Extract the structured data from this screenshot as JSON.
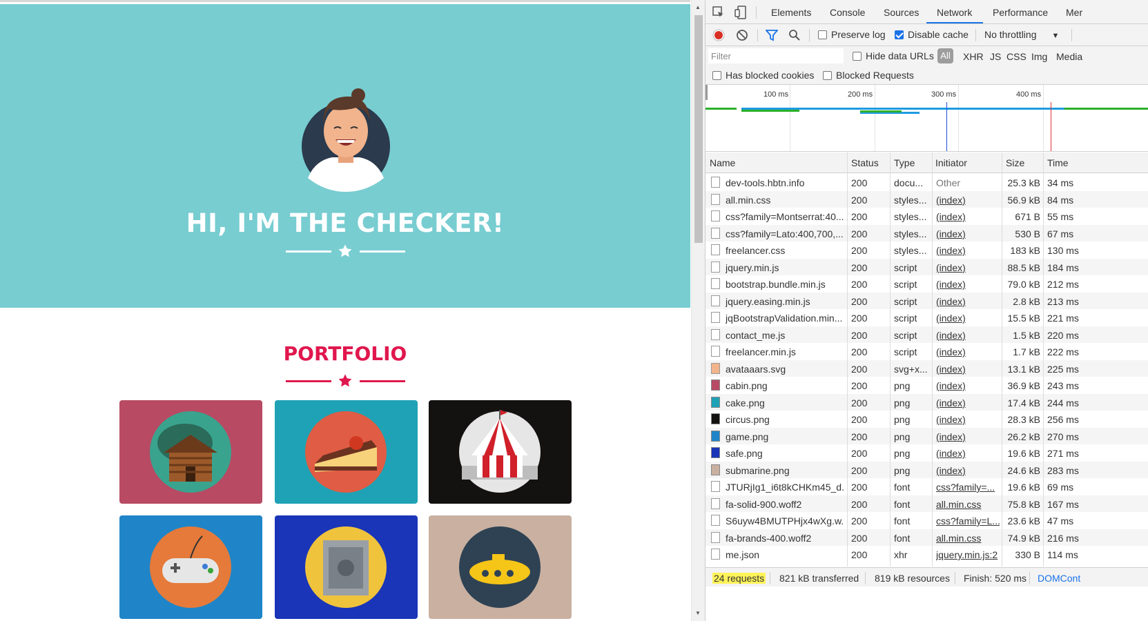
{
  "page": {
    "masthead_title": "HI, I'M THE CHECKER!",
    "portfolio_title": "PORTFOLIO",
    "colors": {
      "masthead": "#78cdd1",
      "accent": "#e0174e"
    }
  },
  "devtools": {
    "tabs": [
      "Elements",
      "Console",
      "Sources",
      "Network",
      "Performance",
      "Mer"
    ],
    "active_tab": "Network",
    "toolbar": {
      "preserve_log": "Preserve log",
      "disable_cache": "Disable cache",
      "throttling": "No throttling"
    },
    "filter": {
      "placeholder": "Filter",
      "hide_data_urls": "Hide data URLs",
      "types": [
        "All",
        "XHR",
        "JS",
        "CSS",
        "Img",
        "Media"
      ]
    },
    "cookies": {
      "has_blocked_cookies": "Has blocked cookies",
      "blocked_requests": "Blocked Requests"
    },
    "timeline": {
      "labels": [
        "100 ms",
        "200 ms",
        "300 ms",
        "400 ms"
      ]
    },
    "columns": [
      "Name",
      "Status",
      "Type",
      "Initiator",
      "Size",
      "Time"
    ],
    "rows": [
      {
        "name": "dev-tools.hbtn.info",
        "status": "200",
        "type": "docu...",
        "initiator": "Other",
        "size": "25.3 kB",
        "time": "34 ms",
        "icon": "file"
      },
      {
        "name": "all.min.css",
        "status": "200",
        "type": "styles...",
        "initiator": "(index)",
        "size": "56.9 kB",
        "time": "84 ms",
        "icon": "file"
      },
      {
        "name": "css?family=Montserrat:40...",
        "status": "200",
        "type": "styles...",
        "initiator": "(index)",
        "size": "671 B",
        "time": "55 ms",
        "icon": "file"
      },
      {
        "name": "css?family=Lato:400,700,...",
        "status": "200",
        "type": "styles...",
        "initiator": "(index)",
        "size": "530 B",
        "time": "67 ms",
        "icon": "file"
      },
      {
        "name": "freelancer.css",
        "status": "200",
        "type": "styles...",
        "initiator": "(index)",
        "size": "183 kB",
        "time": "130 ms",
        "icon": "file"
      },
      {
        "name": "jquery.min.js",
        "status": "200",
        "type": "script",
        "initiator": "(index)",
        "size": "88.5 kB",
        "time": "184 ms",
        "icon": "file"
      },
      {
        "name": "bootstrap.bundle.min.js",
        "status": "200",
        "type": "script",
        "initiator": "(index)",
        "size": "79.0 kB",
        "time": "212 ms",
        "icon": "file"
      },
      {
        "name": "jquery.easing.min.js",
        "status": "200",
        "type": "script",
        "initiator": "(index)",
        "size": "2.8 kB",
        "time": "213 ms",
        "icon": "file"
      },
      {
        "name": "jqBootstrapValidation.min...",
        "status": "200",
        "type": "script",
        "initiator": "(index)",
        "size": "15.5 kB",
        "time": "221 ms",
        "icon": "file"
      },
      {
        "name": "contact_me.js",
        "status": "200",
        "type": "script",
        "initiator": "(index)",
        "size": "1.5 kB",
        "time": "220 ms",
        "icon": "file"
      },
      {
        "name": "freelancer.min.js",
        "status": "200",
        "type": "script",
        "initiator": "(index)",
        "size": "1.7 kB",
        "time": "222 ms",
        "icon": "file"
      },
      {
        "name": "avataaars.svg",
        "status": "200",
        "type": "svg+x...",
        "initiator": "(index)",
        "size": "13.1 kB",
        "time": "225 ms",
        "icon": "avatar"
      },
      {
        "name": "cabin.png",
        "status": "200",
        "type": "png",
        "initiator": "(index)",
        "size": "36.9 kB",
        "time": "243 ms",
        "icon": "img-red"
      },
      {
        "name": "cake.png",
        "status": "200",
        "type": "png",
        "initiator": "(index)",
        "size": "17.4 kB",
        "time": "244 ms",
        "icon": "img-teal"
      },
      {
        "name": "circus.png",
        "status": "200",
        "type": "png",
        "initiator": "(index)",
        "size": "28.3 kB",
        "time": "256 ms",
        "icon": "img-dark"
      },
      {
        "name": "game.png",
        "status": "200",
        "type": "png",
        "initiator": "(index)",
        "size": "26.2 kB",
        "time": "270 ms",
        "icon": "img-blue"
      },
      {
        "name": "safe.png",
        "status": "200",
        "type": "png",
        "initiator": "(index)",
        "size": "19.6 kB",
        "time": "271 ms",
        "icon": "img-navy"
      },
      {
        "name": "submarine.png",
        "status": "200",
        "type": "png",
        "initiator": "(index)",
        "size": "24.6 kB",
        "time": "283 ms",
        "icon": "img-tan"
      },
      {
        "name": "JTURjIg1_i6t8kCHKm45_d...",
        "status": "200",
        "type": "font",
        "initiator": "css?family=...",
        "size": "19.6 kB",
        "time": "69 ms",
        "icon": "file"
      },
      {
        "name": "fa-solid-900.woff2",
        "status": "200",
        "type": "font",
        "initiator": "all.min.css",
        "size": "75.8 kB",
        "time": "167 ms",
        "icon": "file"
      },
      {
        "name": "S6uyw4BMUTPHjx4wXg.w...",
        "status": "200",
        "type": "font",
        "initiator": "css?family=L...",
        "size": "23.6 kB",
        "time": "47 ms",
        "icon": "file"
      },
      {
        "name": "fa-brands-400.woff2",
        "status": "200",
        "type": "font",
        "initiator": "all.min.css",
        "size": "74.9 kB",
        "time": "216 ms",
        "icon": "file"
      },
      {
        "name": "me.json",
        "status": "200",
        "type": "xhr",
        "initiator": "jquery.min.js:2",
        "size": "330 B",
        "time": "114 ms",
        "icon": "file"
      }
    ],
    "status_bar": {
      "requests": "24 requests",
      "transferred": "821 kB transferred",
      "resources": "819 kB resources",
      "finish": "Finish: 520 ms",
      "domcontent": "DOMCont"
    }
  }
}
